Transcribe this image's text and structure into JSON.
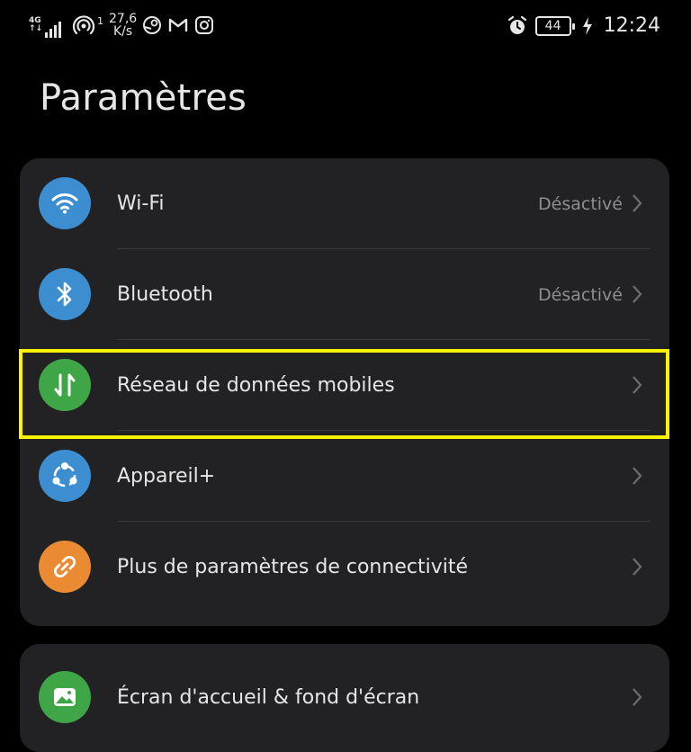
{
  "status_bar": {
    "network_type": "4G",
    "network_sub": "↑↓",
    "hotspot_count": "1",
    "speed_value": "27,6",
    "speed_unit": "K/s",
    "battery_level": "44",
    "time": "12:24",
    "left_icons": [
      "signal-icon",
      "hotspot-icon",
      "steam-icon",
      "gmail-icon",
      "instagram-icon"
    ],
    "right_icons": [
      "alarm-icon",
      "battery-icon",
      "charging-icon"
    ]
  },
  "page": {
    "title": "Paramètres"
  },
  "settings_group_1": {
    "items": [
      {
        "label": "Wi-Fi",
        "value": "Désactivé",
        "icon": "wifi-icon",
        "color": "#3c8ed0"
      },
      {
        "label": "Bluetooth",
        "value": "Désactivé",
        "icon": "bluetooth-icon",
        "color": "#3c8ed0"
      },
      {
        "label": "Réseau de données mobiles",
        "value": "",
        "icon": "mobile-data-icon",
        "color": "#3fa648"
      },
      {
        "label": "Appareil+",
        "value": "",
        "icon": "device-plus-icon",
        "color": "#3c8ed0"
      },
      {
        "label": "Plus de paramètres de connectivité",
        "value": "",
        "icon": "link-icon",
        "color": "#ea8b33"
      }
    ]
  },
  "settings_group_2": {
    "items": [
      {
        "label": "Écran d'accueil & fond d'écran",
        "value": "",
        "icon": "wallpaper-icon",
        "color": "#3fa648"
      }
    ]
  },
  "colors": {
    "background": "#000000",
    "card": "#222224",
    "highlight": "#fff200",
    "secondary_text": "#8e8e90"
  }
}
